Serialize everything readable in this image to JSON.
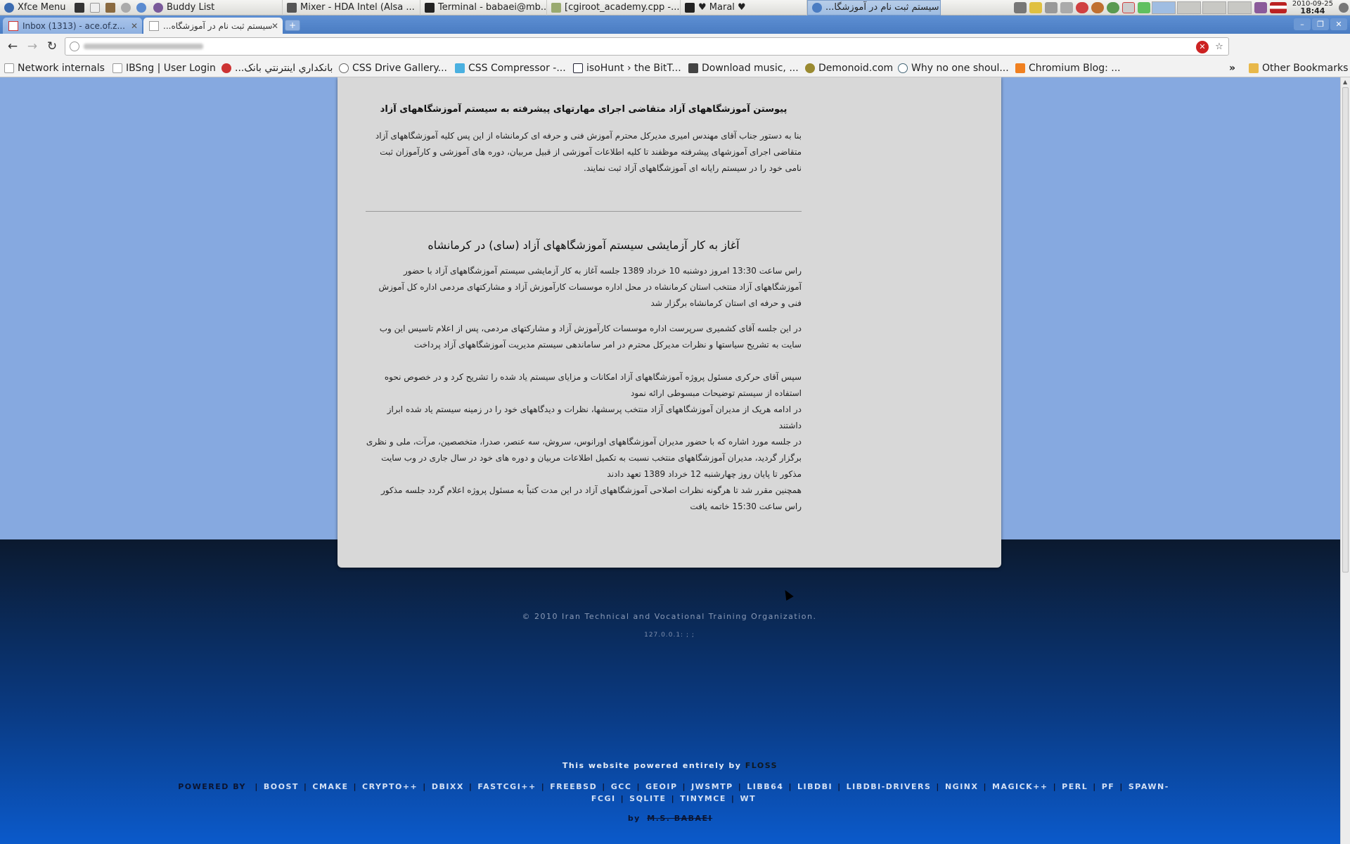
{
  "panel": {
    "menu_label": "Xfce Menu",
    "tasks": [
      {
        "label": "Buddy List"
      },
      {
        "label": "Mixer - HDA Intel (Alsa ..."
      },
      {
        "label": "Terminal - babaei@mb..."
      },
      {
        "label": "[cgiroot_academy.cpp -..."
      },
      {
        "label": "♥ Maral ♥"
      },
      {
        "label": "سیستم ثبت نام در آموزشگا..."
      }
    ],
    "clock_date": "2010-09-25",
    "clock_time": "18:44"
  },
  "browser": {
    "tabs": [
      {
        "label": "Inbox (1313) - ace.of.z..."
      },
      {
        "label": "سیستم ثبت نام در آموزشگاه..."
      }
    ],
    "new_tab_label": "+",
    "bookmarks": [
      {
        "label": "Network internals"
      },
      {
        "label": "IBSng | User Login"
      },
      {
        "label": "بانكداري اينترنتي بانک..."
      },
      {
        "label": "CSS Drive Gallery..."
      },
      {
        "label": "CSS Compressor -..."
      },
      {
        "label": "isoHunt › the BitT..."
      },
      {
        "label": "Download music, ..."
      },
      {
        "label": "Demonoid.com"
      },
      {
        "label": "Why no one shoul..."
      },
      {
        "label": "Chromium Blog: ..."
      }
    ],
    "bookmarks_overflow": "»",
    "other_bookmarks": "Other Bookmarks"
  },
  "page": {
    "article1": {
      "title": "پیوستن آموزشگاههای آزاد متقاضی اجرای مهارتهای پیشرفته به سیستم آموزشگاههای آزاد",
      "body": "بنا به دستور جناب آقای مهندس امیری مدیرکل محترم آموزش فنی و حرفه ای کرمانشاه از این پس کلیه آموزشگاههای آزاد متقاضی اجرای آموزشهای پیشرفته موظفند تا کلیه اطلاعات آموزشی از قبیل مربیان، دوره های آموزشی و کارآموزان ثبت نامی خود را در سیستم رایانه ای آموزشگاههای آزاد ثبت نمایند."
    },
    "article2": {
      "title": "آغاز به کار آزمایشی سیستم آموزشگاههای آزاد (سای) در کرمانشاه",
      "paragraphs": [
        "راس ساعت 13:30 امروز دوشنبه 10 خرداد 1389 جلسه آغاز به کار آزمایشی سیستم آموزشگاههای آزاد با حضور آموزشگاههای آزاد منتخب استان کرمانشاه در محل اداره موسسات کارآموزش آزاد و مشارکتهای مردمی اداره کل آموزش فنی و حرفه ای استان کرمانشاه برگزار شد",
        "در این جلسه آقای کشمیری سرپرست اداره موسسات کارآموزش آزاد و مشارکتهای مردمی، پس از اعلام تاسیس این وب سایت به تشریح سیاستها و نظرات مدیرکل محترم در امر ساماندهی سیستم مدیریت آموزشگاههای آزاد پرداخت",
        "سپس آقای حرکری مسئول پروژه آموزشگاههای آزاد امکانات و مزایای سیستم یاد شده را تشریح کرد و در خصوص نحوه استفاده از سیستم توضیحات مبسوطی ارائه نمود",
        "در ادامه هریک از مدیران آموزشگاههای آزاد منتخب پرسشها، نظرات و دیدگاههای خود را در زمینه سیستم یاد شده ابراز داشتند",
        "در جلسه مورد اشاره که با حضور مدیران آموزشگاههای اورانوس، سروش، سه عنصر، صدرا، متخصصین، مرآت، ملی و نظری برگزار گردید، مدیران آموزشگاههای منتخب نسبت به تکمیل اطلاعات مربیان و دوره های خود در سال جاری در وب سایت مذکور تا پایان روز چهارشنبه 12 خرداد 1389 تعهد دادند",
        "همچنین مقرر شد تا هرگونه نظرات اصلاحی آموزشگاههای آزاد در این مدت کتباً به مسئول پروژه اعلام گردد جلسه مذکور راس ساعت 15:30 خاتمه یافت"
      ]
    },
    "footer": {
      "copyright": "© 2010 Iran Technical and Vocational Training Organization.",
      "ip": "127.0.0.1: ; ;",
      "powered_prefix": "This website powered entirely by",
      "powered_floss": "FLOSS",
      "powered_by_label": "POWERED BY",
      "libs": [
        "BOOST",
        "CMAKE",
        "CRYPTO++",
        "DBIXX",
        "FASTCGI++",
        "FREEBSD",
        "GCC",
        "GEOIP",
        "JWSMTP",
        "LIBB64",
        "LIBDBI",
        "LIBDBI-DRIVERS",
        "NGINX",
        "MAGICK++",
        "PERL",
        "PF",
        "SPAWN-FCGI",
        "SQLITE",
        "TINYMCE",
        "WT"
      ],
      "by_label": "by",
      "author": "M.S. BABAEI"
    }
  },
  "colors": {
    "page_band": "#86a9e0",
    "panel_bg": "#d8d8d8",
    "footer_dark": "#0b1220",
    "footer_blue": "#0b5acb"
  }
}
